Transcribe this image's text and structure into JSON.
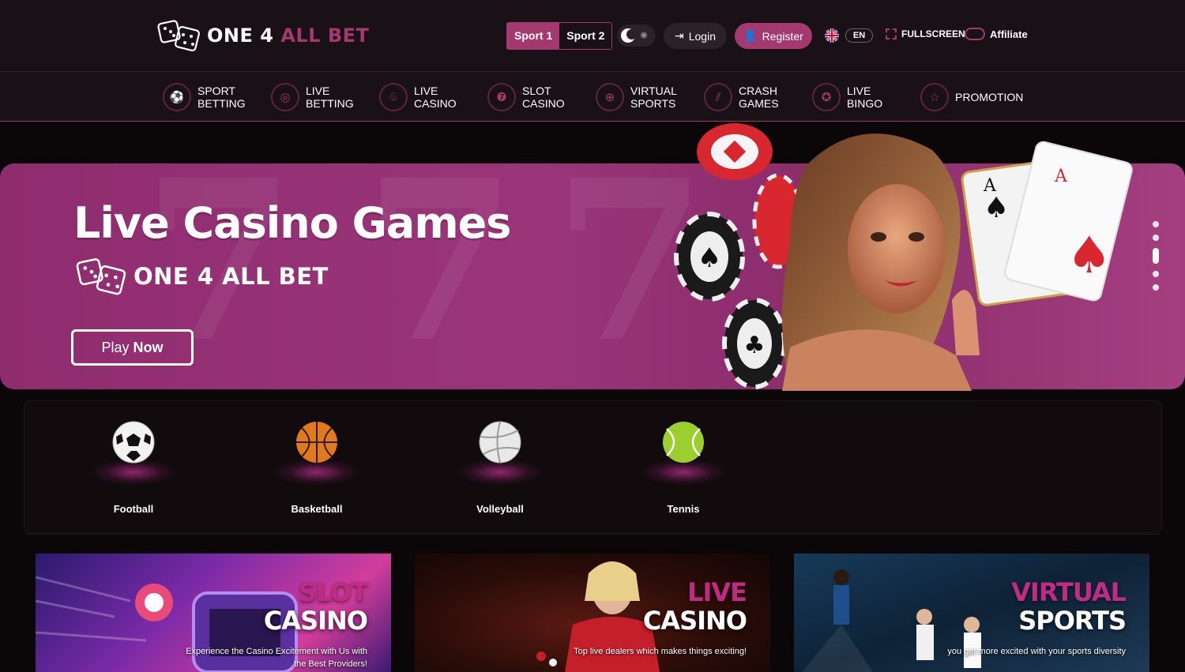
{
  "header": {
    "logo": {
      "word1": "ONE",
      "word2": "4",
      "word3": "ALL BET"
    },
    "sport_switch": [
      "Sport 1",
      "Sport 2"
    ],
    "login_label": "Login",
    "register_label": "Register",
    "language": "EN",
    "fullscreen_label": "FULLSCREEN",
    "affiliate_label": "Affiliate"
  },
  "nav": [
    {
      "line1": "SPORT",
      "line2": "BETTING",
      "icon": "soccer-ball-icon"
    },
    {
      "line1": "LIVE",
      "line2": "BETTING",
      "icon": "live-ball-icon"
    },
    {
      "line1": "LIVE",
      "line2": "CASINO",
      "icon": "club-icon"
    },
    {
      "line1": "SLOT",
      "line2": "CASINO",
      "icon": "slot-icon"
    },
    {
      "line1": "VIRTUAL",
      "line2": "SPORTS",
      "icon": "gamepad-icon"
    },
    {
      "line1": "CRASH",
      "line2": "GAMES",
      "icon": "chart-icon"
    },
    {
      "line1": "LIVE",
      "line2": "BINGO",
      "icon": "bingo-icon"
    },
    {
      "line1": "PROMOTION",
      "line2": "",
      "icon": "star-icon"
    }
  ],
  "hero": {
    "title": "Live Casino Games",
    "logo": {
      "word1": "ONE",
      "word2": "4",
      "word3": "ALL BET"
    },
    "cta_prefix": "Play",
    "cta_bold": "Now",
    "slides_total": 5,
    "active_slide": 3
  },
  "sports": [
    {
      "name": "Football",
      "icon": "football-icon"
    },
    {
      "name": "Basketball",
      "icon": "basketball-icon"
    },
    {
      "name": "Volleyball",
      "icon": "volleyball-icon"
    },
    {
      "name": "Tennis",
      "icon": "tennis-ball-icon"
    }
  ],
  "promos": [
    {
      "title1": "SLOT",
      "title2": "CASINO",
      "desc": "Experience the Casino Excitement with Us with the Best Providers!"
    },
    {
      "title1": "LIVE",
      "title2": "CASINO",
      "desc": "Top live dealers which makes things exciting!"
    },
    {
      "title1": "VIRTUAL",
      "title2": "SPORTS",
      "desc": "you get more excited with your sports diversity"
    }
  ],
  "colors": {
    "accent": "#a3396f",
    "background": "#0b0709",
    "bar": "#1a1116"
  }
}
